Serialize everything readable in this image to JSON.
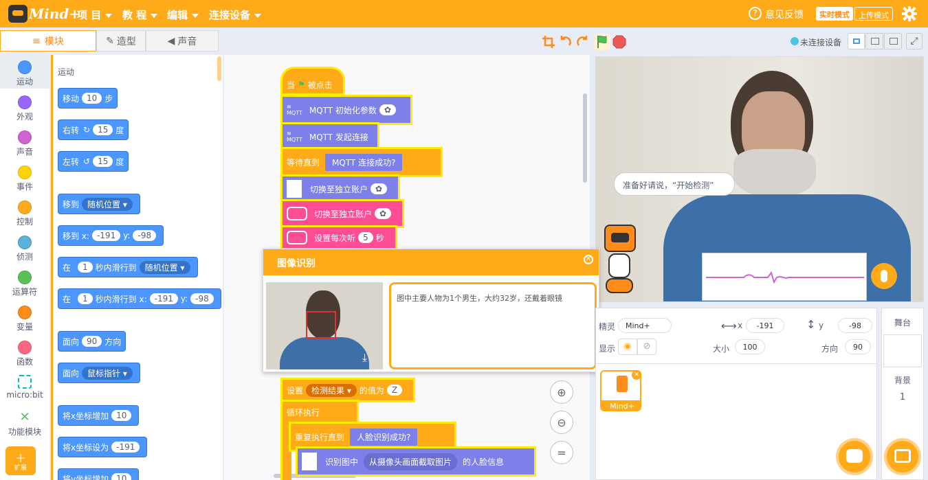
{
  "header": {
    "logo_text": "Mind+",
    "menus": [
      "项 目",
      "教 程",
      "编辑",
      "连接设备"
    ],
    "feedback": "意见反馈",
    "mode_realtime": "实时模式",
    "mode_upload": "上传模式"
  },
  "tabs": [
    "模块",
    "造型",
    "声音"
  ],
  "stage_toolbar": {
    "device_status": "未连接设备"
  },
  "categories": [
    {
      "label": "运动",
      "color": "#4c97ff"
    },
    {
      "label": "外观",
      "color": "#9966ff"
    },
    {
      "label": "声音",
      "color": "#cf63cf"
    },
    {
      "label": "事件",
      "color": "#ffd500"
    },
    {
      "label": "控制",
      "color": "#ffab19"
    },
    {
      "label": "侦测",
      "color": "#5cb1d6"
    },
    {
      "label": "运算符",
      "color": "#59c059"
    },
    {
      "label": "变量",
      "color": "#ff8c1a"
    },
    {
      "label": "函数",
      "color": "#ff6680"
    },
    {
      "label": "micro:bit",
      "color": "#00b8d4"
    },
    {
      "label": "功能模块",
      "color": "#59c059"
    }
  ],
  "extension_label": "扩展",
  "palette": {
    "section": "运动",
    "b1": {
      "a": "移动",
      "v": "10",
      "b": "步"
    },
    "b2": {
      "a": "右转",
      "v": "15",
      "b": "度"
    },
    "b3": {
      "a": "左转",
      "v": "15",
      "b": "度"
    },
    "b4": {
      "a": "移到",
      "d": "随机位置"
    },
    "b5": {
      "a": "移到 x:",
      "x": "-191",
      "b": "y:",
      "y": "-98"
    },
    "b6": {
      "a": "在",
      "v": "1",
      "b": "秒内滑行到",
      "d": "随机位置"
    },
    "b7": {
      "a": "在",
      "v": "1",
      "b": "秒内滑行到 x:",
      "x": "-191",
      "c": "y:",
      "y": "-98"
    },
    "b8": {
      "a": "面向",
      "v": "90",
      "b": "方向"
    },
    "b9": {
      "a": "面向",
      "d": "鼠标指针"
    },
    "b10": {
      "a": "将x坐标增加",
      "v": "10"
    },
    "b11": {
      "a": "将x坐标设为",
      "v": "-191"
    },
    "b12": {
      "a": "将y坐标增加",
      "v": "10"
    }
  },
  "script": {
    "hat": {
      "a": "当",
      "b": "被点击"
    },
    "mqtt_init": "MQTT 初始化参数",
    "mqtt_connect": "MQTT 发起连接",
    "wait_until": "等待直到",
    "mqtt_ok": "MQTT 连接成功?",
    "switch1": "切换至独立账户",
    "switch2": "切换至独立账户",
    "listen": {
      "a": "设置每次听",
      "v": "5",
      "b": "秒"
    },
    "set_var": {
      "a": "设置",
      "d": "检测结果",
      "b": "的值为",
      "v": "Z"
    },
    "loop": "循环执行",
    "repeat_until": "重复执行直到",
    "face_ok": "人脸识别成功?",
    "recognize": {
      "a": "识别图中",
      "b": "从摄像头画面截取图片",
      "c": "的人脸信息"
    },
    "mqtt_icon_label": "MQTT"
  },
  "dialog": {
    "title": "图像识别",
    "result": "图中主要人物为1个男生，大约32岁，还戴着眼镜"
  },
  "stage": {
    "speech": "准备好请说，“开始检测”",
    "sprite_name": "Mind+"
  },
  "sprite_panel": {
    "sprite_label": "精灵",
    "sprite_name": "Mind+",
    "x_label": "x",
    "x": "-191",
    "y_label": "y",
    "y": "-98",
    "show_label": "显示",
    "size_label": "大小",
    "size": "100",
    "dir_label": "方向",
    "dir": "90",
    "thumb_name": "Mind+"
  },
  "backdrop_panel": {
    "title": "舞台",
    "label": "背景",
    "count": "1"
  }
}
